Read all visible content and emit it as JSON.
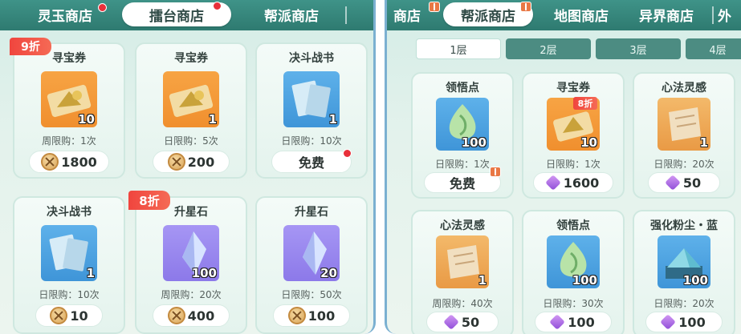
{
  "left_panel": {
    "tabs": [
      "灵玉商店",
      "擂台商店",
      "帮派商店"
    ],
    "active_tab": 1,
    "items": [
      {
        "title": "寻宝券",
        "icon": "scroll-map-icon",
        "qty": "10",
        "limit": "周限购：1次",
        "price": "1800",
        "currency": "coin-icon",
        "badge": "9折"
      },
      {
        "title": "寻宝券",
        "icon": "scroll-map-icon",
        "qty": "1",
        "limit": "日限购：5次",
        "price": "200",
        "currency": "coin-icon"
      },
      {
        "title": "决斗战书",
        "icon": "book-icon",
        "qty": "1",
        "limit": "日限购：10次",
        "price": "免费",
        "currency": "",
        "alert": true
      },
      {
        "title": "决斗战书",
        "icon": "book-icon",
        "qty": "1",
        "limit": "日限购：10次",
        "price": "10",
        "currency": "coin-icon"
      },
      {
        "title": "升星石",
        "icon": "crystal-icon",
        "qty": "100",
        "limit": "周限购：20次",
        "price": "400",
        "currency": "coin-icon",
        "badge": "8折"
      },
      {
        "title": "升星石",
        "icon": "crystal-icon",
        "qty": "20",
        "limit": "日限购：50次",
        "price": "100",
        "currency": "coin-icon"
      }
    ]
  },
  "right_panel": {
    "tabs": [
      "商店",
      "帮派商店",
      "地图商店",
      "异界商店",
      "外"
    ],
    "active_tab": 1,
    "floors": [
      "1层",
      "2层",
      "3层",
      "4层"
    ],
    "active_floor": 0,
    "items": [
      {
        "title": "领悟点",
        "icon": "jade-drop-icon",
        "qty": "100",
        "limit": "日限购：1次",
        "price": "免费",
        "currency": "",
        "gift": true
      },
      {
        "title": "寻宝券",
        "icon": "scroll-map-icon",
        "qty": "10",
        "limit": "日限购：1次",
        "price": "1600",
        "currency": "gem-icon",
        "badge": "8折"
      },
      {
        "title": "心法灵感",
        "icon": "paper-scroll-icon",
        "qty": "1",
        "limit": "日限购：20次",
        "price": "50",
        "currency": "gem-icon"
      },
      {
        "title": "心法灵感",
        "icon": "paper-scroll-icon",
        "qty": "1",
        "limit": "周限购：40次",
        "price": "50",
        "currency": "gem-icon"
      },
      {
        "title": "领悟点",
        "icon": "jade-drop-icon",
        "qty": "100",
        "limit": "日限购：30次",
        "price": "100",
        "currency": "gem-icon"
      },
      {
        "title": "强化粉尘・蓝",
        "icon": "blue-dust-icon",
        "qty": "100",
        "limit": "日限购：20次",
        "price": "100",
        "currency": "gem-icon"
      }
    ]
  }
}
